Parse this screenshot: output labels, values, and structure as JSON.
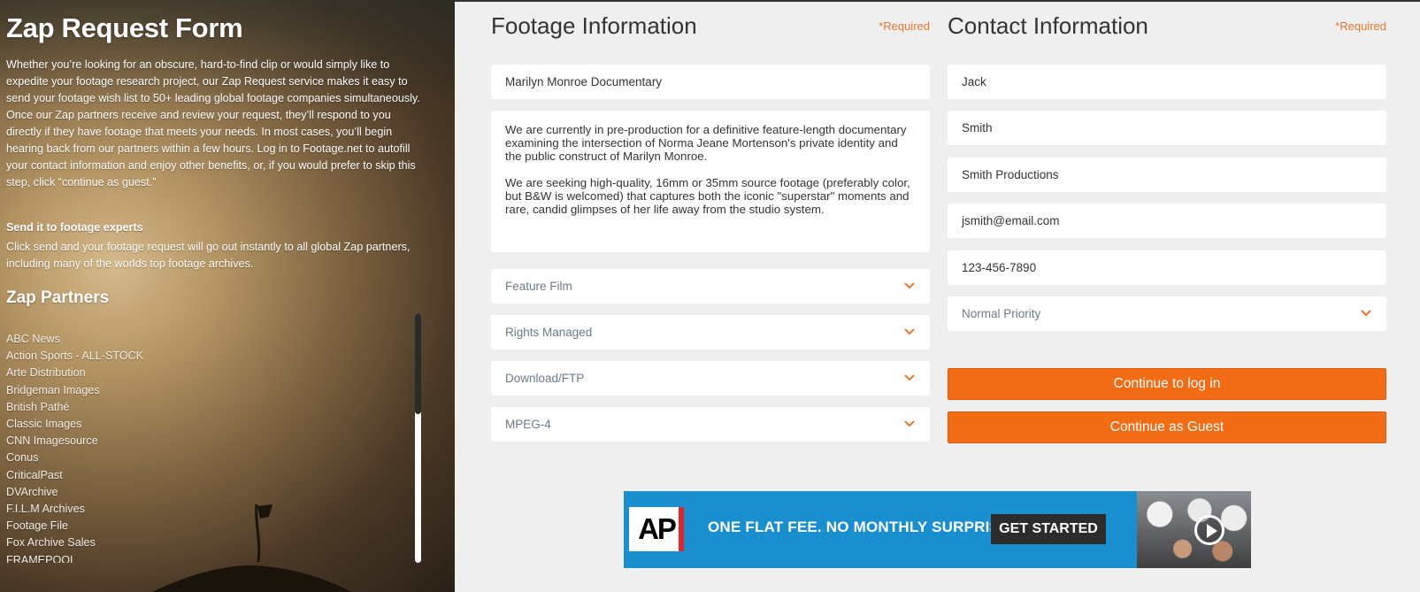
{
  "hero": {
    "title": "Zap Request Form",
    "intro": "Whether you’re looking for an obscure, hard-to-find clip or would simply like to expedite your footage research project, our Zap Request service makes it easy to send your footage wish list to 50+ leading global footage companies simultaneously. Once our Zap partners receive and review your request, they’ll respond to you directly if they have footage that meets your needs. In most cases, you’ll begin hearing back from our partners within a few hours. Log in to Footage.net to autofill your contact information and enjoy other benefits, or, if you would prefer to skip this step, click “continue as guest.”",
    "send_heading": "Send it to footage experts",
    "send_text": "Click send and your footage request will go out instantly to all global Zap partners, including many of the worlds top footage archives.",
    "partners_heading": "Zap Partners",
    "partners": [
      "ABC News",
      "Action Sports - ALL-STOCK",
      "Arte Distribution",
      "Bridgeman Images",
      "British Pathé",
      "Classic Images",
      "CNN Imagesource",
      "Conus",
      "CriticalPast",
      "DVArchive",
      "F.I.L.M Archives",
      "Footage File",
      "Fox Archive Sales",
      "FRAMEPOOL"
    ]
  },
  "footage": {
    "title": "Footage Information",
    "required": "*Required",
    "project_title": "Marilyn Monroe Documentary",
    "description_p1": "We are currently in pre-production for a definitive feature-length documentary examining the intersection of Norma Jeane Mortenson's private identity and the public construct of Marilyn Monroe.",
    "description_p2": "We are seeking high-quality, 16mm or 35mm source footage (preferably color, but B&W is welcomed) that captures both the iconic \"superstar\" moments and rare, candid glimpses of her life away from the studio system.",
    "production_type": "Feature Film",
    "license_type": "Rights Managed",
    "delivery": "Download/FTP",
    "format": "MPEG-4"
  },
  "contact": {
    "title": "Contact Information",
    "required": "*Required",
    "first_name": "Jack",
    "last_name": "Smith",
    "company": "Smith Productions",
    "email": "jsmith@email.com",
    "phone": "123-456-7890",
    "priority": "Normal Priority",
    "login_button": "Continue to log in",
    "guest_button": "Continue as Guest"
  },
  "banner": {
    "logo": "AP",
    "tagline": "ONE FLAT FEE. NO MONTHLY SURPRISES.",
    "cta": "GET STARTED"
  },
  "colors": {
    "accent": "#f26c16",
    "required": "#e8752d",
    "banner_bg": "#1a8fd0"
  }
}
